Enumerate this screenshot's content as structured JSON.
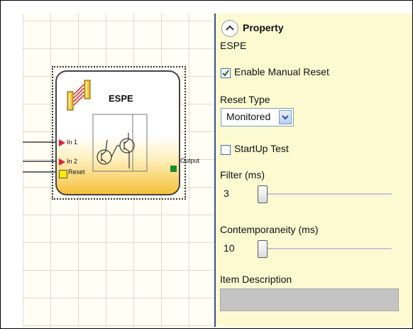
{
  "block": {
    "title": "ESPE",
    "inputs": [
      "In 1",
      "In 2"
    ],
    "reset_label": "Reset",
    "output_label": "Output"
  },
  "property_panel": {
    "header": "Property",
    "subtitle": "ESPE",
    "enable_manual_reset": {
      "label": "Enable Manual Reset",
      "checked": true
    },
    "reset_type": {
      "label": "Reset Type",
      "value": "Monitored"
    },
    "startup_test": {
      "label": "StartUp Test",
      "checked": false
    },
    "filter": {
      "label": "Filter (ms)",
      "value": "3"
    },
    "contemporaneity": {
      "label": "Contemporaneity (ms)",
      "value": "10"
    },
    "item_description": {
      "label": "Item Description",
      "value": ""
    }
  },
  "colors": {
    "panel_bg": "#fdfad2",
    "block_gradient_bottom": "#f5c13b",
    "input_pin": "#e0203a",
    "output_pin": "#1f8a2d",
    "reset_pin": "#ffea00"
  },
  "icons": [
    "espe-light-curtain-icon",
    "collapse-chevron-up-icon",
    "dropdown-chevron-icon",
    "checkmark-icon"
  ]
}
